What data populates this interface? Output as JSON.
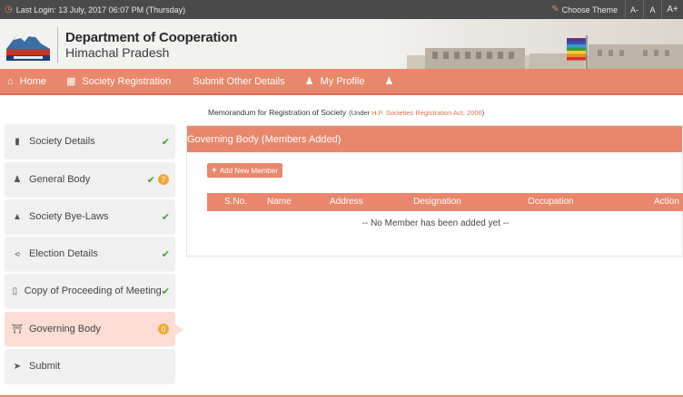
{
  "topbar": {
    "last_login": "Last Login: 13 July, 2017 06:07 PM (Thursday)",
    "choose_theme": "Choose Theme",
    "font_small": "A-",
    "font_normal": "A",
    "font_large": "A+"
  },
  "header": {
    "org_name": "Department of Cooperation",
    "org_state": "Himachal Pradesh"
  },
  "nav": {
    "items": [
      {
        "label": "Home",
        "icon": "home-icon"
      },
      {
        "label": "Society Registration",
        "icon": "document-icon"
      },
      {
        "label": "Submit Other Details",
        "icon": ""
      },
      {
        "label": "My Profile",
        "icon": "user-icon"
      },
      {
        "label": "",
        "icon": "user-icon"
      }
    ]
  },
  "page": {
    "memo": "Memorandum for Registration of Society",
    "under_prefix": "(Under ",
    "act": "H.P. Societies Registration Act, 2006",
    "under_suffix": ")"
  },
  "sidebar": {
    "items": [
      {
        "label": "Society Details",
        "icon": "book-icon",
        "status": "complete"
      },
      {
        "label": "General Body",
        "icon": "users-icon",
        "status": "complete",
        "badge": "7"
      },
      {
        "label": "Society Bye-Laws",
        "icon": "graduation-cap-icon",
        "status": "complete"
      },
      {
        "label": "Election Details",
        "icon": "share-icon",
        "status": "complete"
      },
      {
        "label": "Copy of Proceeding of Meeting",
        "icon": "file-icon",
        "status": "complete"
      },
      {
        "label": "Governing Body",
        "icon": "institution-icon",
        "status": "active",
        "badge": "0"
      },
      {
        "label": "Submit",
        "icon": "send-icon",
        "status": "pending"
      }
    ]
  },
  "panel": {
    "title": "Governing Body (Members Added)",
    "add_button": "Add New Member",
    "columns": [
      "S.No.",
      "Name",
      "Address",
      "Designation",
      "Occupation",
      "Action"
    ],
    "empty_message": "-- No Member has been added yet --"
  },
  "colors": {
    "accent": "#e8876c",
    "topbar": "#4a4a4a",
    "check": "#4a9b3a",
    "badge": "#f0a93a",
    "active_item": "#fcdcd3"
  }
}
